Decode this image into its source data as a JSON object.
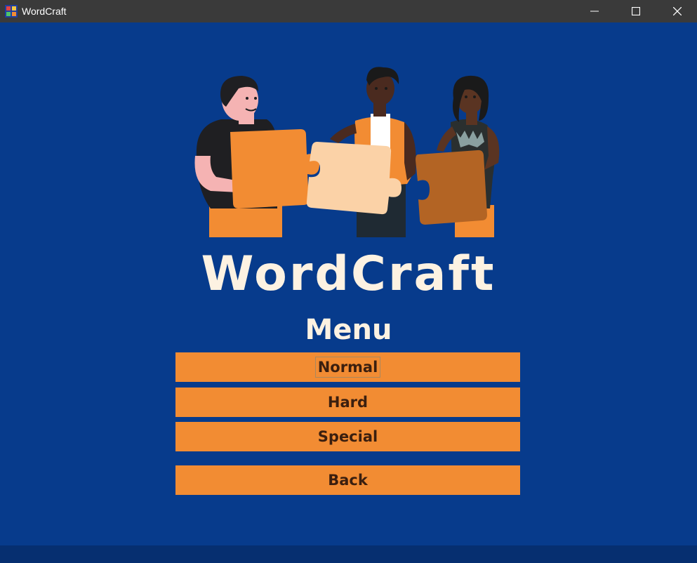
{
  "window": {
    "title": "WordCraft",
    "icon": "app-icon",
    "controls": [
      "minimize-icon",
      "maximize-icon",
      "close-icon"
    ]
  },
  "game": {
    "title": "WordCraft",
    "heading": "Menu"
  },
  "menu": {
    "normal_label": "Normal",
    "hard_label": "Hard",
    "special_label": "Special",
    "back_label": "Back",
    "focused": "Normal"
  },
  "colors": {
    "background": "#073b8c",
    "titlebar": "#3a3a3a",
    "button": "#f28c33",
    "button_text": "#3b1f0f",
    "title_text": "#fdf2e2"
  }
}
